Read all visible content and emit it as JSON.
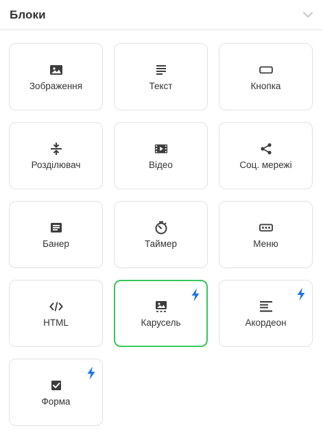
{
  "header": {
    "title": "Блоки"
  },
  "colors": {
    "accent_selected": "#35c65a",
    "bolt": "#1e73e8",
    "icon": "#3d3d3d"
  },
  "blocks": [
    {
      "label": "Зображення",
      "icon": "image-icon"
    },
    {
      "label": "Текст",
      "icon": "text-icon"
    },
    {
      "label": "Кнопка",
      "icon": "button-icon"
    },
    {
      "label": "Розділювач",
      "icon": "divider-icon"
    },
    {
      "label": "Відео",
      "icon": "video-icon"
    },
    {
      "label": "Соц. мережі",
      "icon": "share-icon"
    },
    {
      "label": "Банер",
      "icon": "banner-icon"
    },
    {
      "label": "Таймер",
      "icon": "timer-icon"
    },
    {
      "label": "Меню",
      "icon": "menu-icon"
    },
    {
      "label": "HTML",
      "icon": "code-icon"
    },
    {
      "label": "Карусель",
      "icon": "carousel-icon",
      "premium": true,
      "selected": true
    },
    {
      "label": "Акордеон",
      "icon": "accordion-icon",
      "premium": true
    },
    {
      "label": "Форма",
      "icon": "form-icon",
      "premium": true
    }
  ]
}
